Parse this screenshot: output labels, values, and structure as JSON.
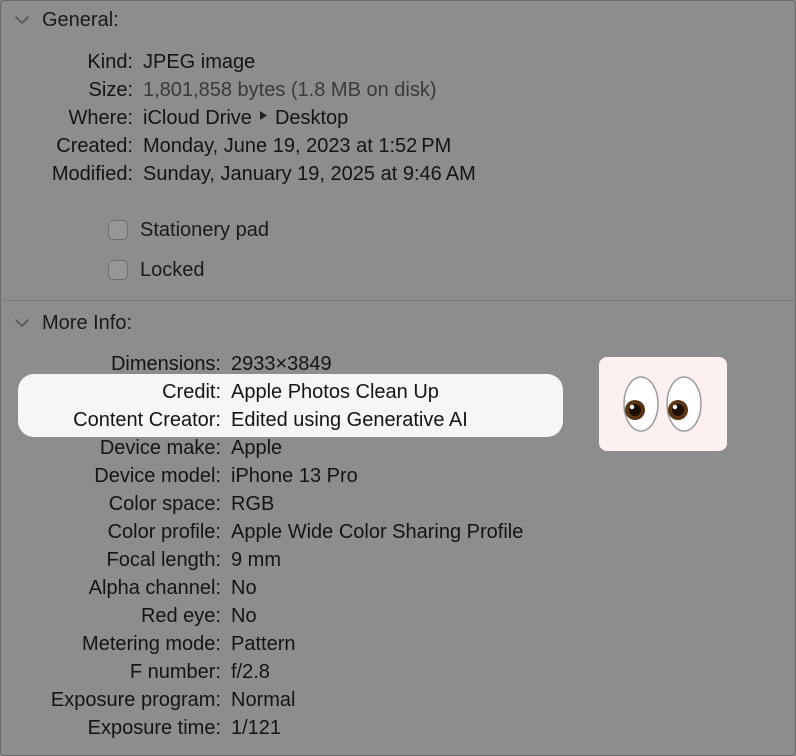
{
  "general": {
    "header": "General:",
    "rows": [
      {
        "label": "Kind:",
        "value": "JPEG image"
      },
      {
        "label": "Size:",
        "value": "1,801,858 bytes (1.8 MB on disk)"
      },
      {
        "label": "Where:",
        "value_a": "iCloud Drive",
        "value_b": "Desktop"
      },
      {
        "label": "Created:",
        "value": "Monday, June 19, 2023 at 1:52 PM"
      },
      {
        "label": "Modified:",
        "value": "Sunday, January 19, 2025 at 9:46 AM"
      }
    ],
    "checkboxes": [
      {
        "label": "Stationery pad",
        "checked": false
      },
      {
        "label": "Locked",
        "checked": false
      }
    ]
  },
  "more_info": {
    "header": "More Info:",
    "rows": [
      {
        "label": "Dimensions:",
        "value": "2933×3849"
      },
      {
        "label": "Credit:",
        "value": "Apple Photos Clean Up"
      },
      {
        "label": "Content Creator:",
        "value": "Edited using Generative AI"
      },
      {
        "label": "Device make:",
        "value": "Apple"
      },
      {
        "label": "Device model:",
        "value": "iPhone 13 Pro"
      },
      {
        "label": "Color space:",
        "value": "RGB"
      },
      {
        "label": "Color profile:",
        "value": "Apple Wide Color Sharing Profile"
      },
      {
        "label": "Focal length:",
        "value": "9 mm"
      },
      {
        "label": "Alpha channel:",
        "value": "No"
      },
      {
        "label": "Red eye:",
        "value": "No"
      },
      {
        "label": "Metering mode:",
        "value": "Pattern"
      },
      {
        "label": "F number:",
        "value": "f/2.8"
      },
      {
        "label": "Exposure program:",
        "value": "Normal"
      },
      {
        "label": "Exposure time:",
        "value": "1/121"
      }
    ]
  },
  "colors": {
    "panel_bg": "#8d8d8d",
    "highlight_bg": "#f6f6f6",
    "emoji_card_bg": "#fdf0f1"
  },
  "icons": {
    "disclosure": "chevron-down-icon",
    "path_separator": "triangle-right-icon",
    "emoji": "eyes-emoji-icon"
  }
}
